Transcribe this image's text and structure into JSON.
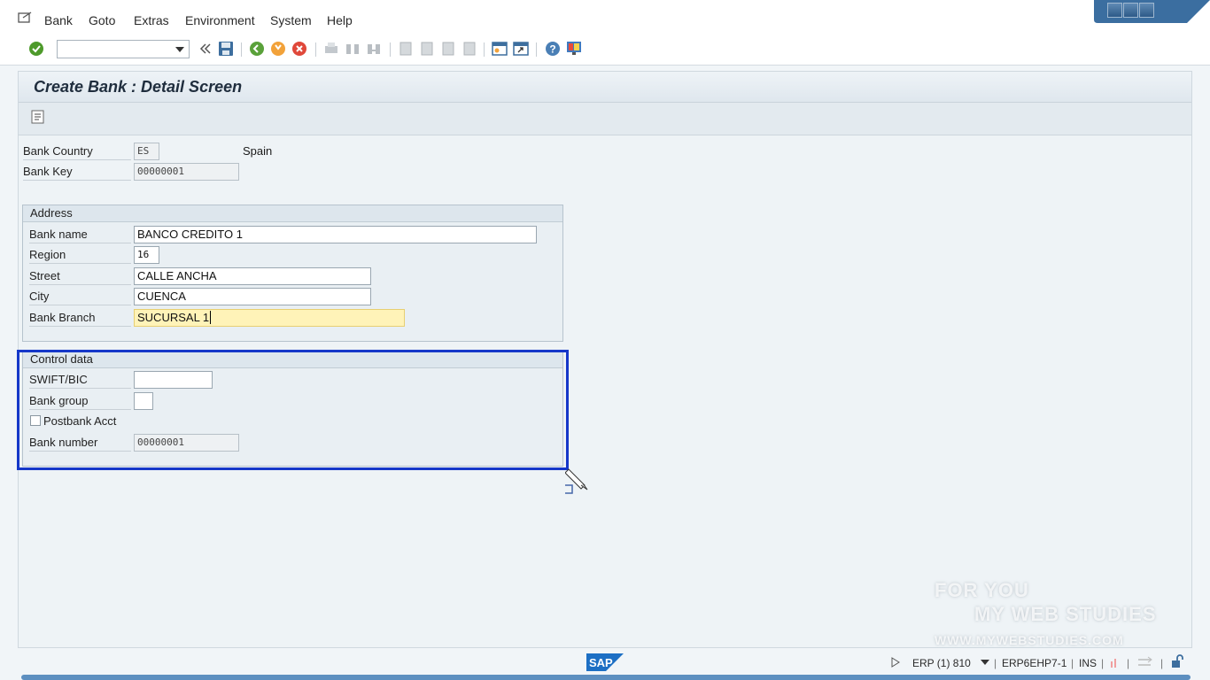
{
  "menu": {
    "items": [
      "Bank",
      "Goto",
      "Extras",
      "Environment",
      "System",
      "Help"
    ]
  },
  "toolbar": {
    "command_value": "",
    "icons": [
      "enter-icon",
      "save-icon",
      "back-icon",
      "exit-icon",
      "cancel-icon",
      "print-icon",
      "find-icon",
      "find-next-icon",
      "first-page-icon",
      "previous-page-icon",
      "next-page-icon",
      "last-page-icon",
      "create-session-icon",
      "shortcut-icon",
      "help-icon",
      "customize-layout-icon"
    ]
  },
  "screen": {
    "title": "Create Bank : Detail Screen"
  },
  "header_fields": {
    "bank_country_label": "Bank Country",
    "bank_country_value": "ES",
    "bank_country_name": "Spain",
    "bank_key_label": "Bank Key",
    "bank_key_value": "00000001"
  },
  "address": {
    "title": "Address",
    "bank_name_label": "Bank name",
    "bank_name_value": "BANCO CREDITO 1",
    "region_label": "Region",
    "region_value": "16",
    "street_label": "Street",
    "street_value": "CALLE ANCHA",
    "city_label": "City",
    "city_value": "CUENCA",
    "branch_label": "Bank Branch",
    "branch_value": "SUCURSAL 1"
  },
  "control": {
    "title": "Control data",
    "swift_label": "SWIFT/BIC",
    "swift_value": "",
    "group_label": "Bank group",
    "group_value": "",
    "postbank_label": "Postbank Acct",
    "bank_number_label": "Bank number",
    "bank_number_value": "00000001"
  },
  "status": {
    "system": "ERP (1) 810",
    "server": "ERP6EHP7-1",
    "mode": "INS"
  },
  "watermark": {
    "line1": "FOR YOU",
    "line2": "MY WEB STUDIES",
    "line3": "WWW.MYWEBSTUDIES.COM"
  },
  "colors": {
    "highlight": "#1537c9",
    "active_field": "#fff3b8",
    "sap_blue": "#1d6fc4"
  }
}
